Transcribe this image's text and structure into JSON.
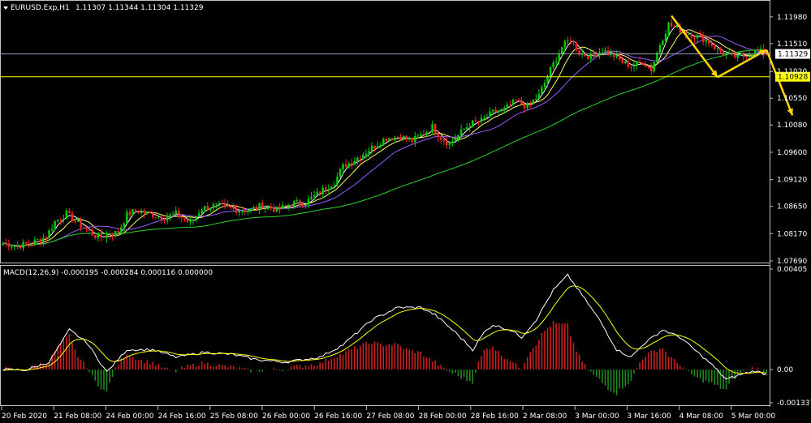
{
  "header": {
    "symbol_label": "EURUSD.Exp,H1",
    "ohlc_label": "1.11307 1.11344 1.11304 1.11329",
    "indicator_label": "MACD(12,26,9) -0.000195 -0.000284 0.000116 0.000000"
  },
  "colors": {
    "background": "#000000",
    "grid": "#c0c0c0",
    "bull_candle": "#00cc00",
    "bear_candle": "#ff2020",
    "ma_fast": "#ffffff",
    "ma_mid": "#ffff66",
    "ma_slow_purple": "#9b5cff",
    "ma_long_green": "#2bd42b",
    "arrows": "#ffd400",
    "macd_line": "#ffffff",
    "signal_line": "#ffff00",
    "hist_positive": "#cc2020",
    "hist_negative": "#1f8a1f",
    "price_tag_bg": "#ffffff",
    "level_tag_bg": "#ffff00"
  },
  "chart_data": [
    {
      "type": "candlestick",
      "symbol": "EURUSD.Exp",
      "timeframe": "H1",
      "ylim": [
        1.0769,
        1.1222
      ],
      "y_ticks": [
        "1.11980",
        "1.11510",
        "1.11020",
        "1.10550",
        "1.10080",
        "1.09600",
        "1.09120",
        "1.08650",
        "1.08170",
        "1.07690"
      ],
      "x_ticks": [
        "20 Feb 2020",
        "21 Feb 08:00",
        "24 Feb 00:00",
        "24 Feb 16:00",
        "25 Feb 08:00",
        "26 Feb 00:00",
        "26 Feb 16:00",
        "27 Feb 08:00",
        "28 Feb 00:00",
        "28 Feb 16:00",
        "2 Mar 08:00",
        "3 Mar 00:00",
        "3 Mar 16:00",
        "4 Mar 08:00",
        "5 Mar 00:00"
      ],
      "current_price": "1.11329",
      "level_price": "1.10928",
      "price_path": [
        [
          0,
          1.08
        ],
        [
          5,
          1.0795
        ],
        [
          10,
          1.0801
        ],
        [
          15,
          1.0812
        ],
        [
          18,
          1.0838
        ],
        [
          22,
          1.0852
        ],
        [
          26,
          1.0835
        ],
        [
          30,
          1.082
        ],
        [
          33,
          1.081
        ],
        [
          36,
          1.0814
        ],
        [
          40,
          1.082
        ],
        [
          43,
          1.085
        ],
        [
          46,
          1.0858
        ],
        [
          52,
          1.085
        ],
        [
          56,
          1.0845
        ],
        [
          60,
          1.0852
        ],
        [
          65,
          1.0835
        ],
        [
          69,
          1.0862
        ],
        [
          74,
          1.0866
        ],
        [
          80,
          1.086
        ],
        [
          86,
          1.0858
        ],
        [
          90,
          1.0868
        ],
        [
          95,
          1.0858
        ],
        [
          100,
          1.087
        ],
        [
          105,
          1.0872
        ],
        [
          110,
          1.089
        ],
        [
          115,
          1.0908
        ],
        [
          118,
          1.0935
        ],
        [
          123,
          1.095
        ],
        [
          128,
          1.0968
        ],
        [
          133,
          1.0985
        ],
        [
          138,
          1.0988
        ],
        [
          142,
          1.098
        ],
        [
          145,
          1.099
        ],
        [
          149,
          1.1005
        ],
        [
          152,
          1.0985
        ],
        [
          155,
          1.0975
        ],
        [
          158,
          1.099
        ],
        [
          162,
          1.101
        ],
        [
          166,
          1.1015
        ],
        [
          170,
          1.103
        ],
        [
          174,
          1.1035
        ],
        [
          178,
          1.105
        ],
        [
          182,
          1.104
        ],
        [
          186,
          1.106
        ],
        [
          190,
          1.1105
        ],
        [
          194,
          1.1145
        ],
        [
          197,
          1.116
        ],
        [
          200,
          1.1135
        ],
        [
          204,
          1.1128
        ],
        [
          208,
          1.114
        ],
        [
          212,
          1.113
        ],
        [
          215,
          1.1118
        ],
        [
          218,
          1.1112
        ],
        [
          222,
          1.1118
        ],
        [
          225,
          1.1105
        ],
        [
          228,
          1.115
        ],
        [
          231,
          1.1185
        ],
        [
          235,
          1.1175
        ],
        [
          240,
          1.1165
        ],
        [
          244,
          1.1158
        ],
        [
          248,
          1.114
        ],
        [
          252,
          1.113
        ],
        [
          255,
          1.1126
        ],
        [
          258,
          1.1132
        ],
        [
          262,
          1.1138
        ],
        [
          265,
          1.1133
        ]
      ],
      "macd_path": [
        [
          0,
          0.0
        ],
        [
          8,
          -2e-05
        ],
        [
          16,
          0.0003
        ],
        [
          23,
          0.0016
        ],
        [
          29,
          0.0011
        ],
        [
          36,
          -0.0001
        ],
        [
          43,
          0.0008
        ],
        [
          52,
          0.0008
        ],
        [
          60,
          0.0005
        ],
        [
          70,
          0.0007
        ],
        [
          80,
          0.0006
        ],
        [
          88,
          0.0004
        ],
        [
          98,
          0.0003
        ],
        [
          110,
          0.0005
        ],
        [
          118,
          0.001
        ],
        [
          128,
          0.002
        ],
        [
          137,
          0.0025
        ],
        [
          145,
          0.0025
        ],
        [
          150,
          0.0022
        ],
        [
          157,
          0.0015
        ],
        [
          163,
          0.0008
        ],
        [
          167,
          0.0015
        ],
        [
          170,
          0.0018
        ],
        [
          176,
          0.0016
        ],
        [
          180,
          0.0013
        ],
        [
          185,
          0.002
        ],
        [
          191,
          0.0032
        ],
        [
          196,
          0.0038
        ],
        [
          201,
          0.003
        ],
        [
          207,
          0.002
        ],
        [
          213,
          0.0008
        ],
        [
          218,
          0.0005
        ],
        [
          222,
          0.001
        ],
        [
          229,
          0.0016
        ],
        [
          235,
          0.0013
        ],
        [
          240,
          0.0008
        ],
        [
          246,
          0.0002
        ],
        [
          251,
          -0.0004
        ],
        [
          256,
          -0.0002
        ],
        [
          261,
          -5e-05
        ],
        [
          265,
          -0.0002
        ]
      ],
      "arrows": [
        {
          "from": [
            232,
            1.12
          ],
          "to": [
            248,
            1.1092
          ]
        },
        {
          "from": [
            248,
            1.1092
          ],
          "to": [
            265,
            1.114
          ]
        },
        {
          "from": [
            265,
            1.114
          ],
          "to": [
            274,
            1.1025
          ]
        }
      ]
    },
    {
      "type": "macd",
      "params": "12,26,9",
      "ylim": [
        -0.00137,
        0.00405
      ],
      "y_ticks": [
        "0.00405",
        "0.00",
        "-0.001337"
      ]
    }
  ]
}
